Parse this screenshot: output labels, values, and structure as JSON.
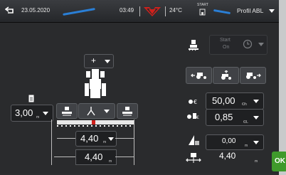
{
  "topbar": {
    "date": "23.05.2020",
    "time": "03:49",
    "temperature": "24°C",
    "start_label": "START",
    "profile": "Profil ABL"
  },
  "start_on": {
    "label_line1": "Start",
    "label_line2": "On"
  },
  "rates": {
    "rate1": {
      "value": "50,00",
      "unit": "€/h"
    },
    "rate2": {
      "value": "0,85",
      "unit": "€/L"
    }
  },
  "left_width": {
    "value": "3,00",
    "unit": "m"
  },
  "boom_width": {
    "value": "4,40",
    "unit": "m"
  },
  "total_width": {
    "value": "4,40",
    "unit": "m"
  },
  "overlap": {
    "value": "0,00",
    "unit": "m"
  },
  "spacing": {
    "value": "4,40",
    "unit": "m"
  },
  "plus_label": "+",
  "ok_label": "OK",
  "colors": {
    "accent_blue": "#2a7fd6",
    "red": "#d0211c",
    "ok_green": "#3f9a2b"
  }
}
